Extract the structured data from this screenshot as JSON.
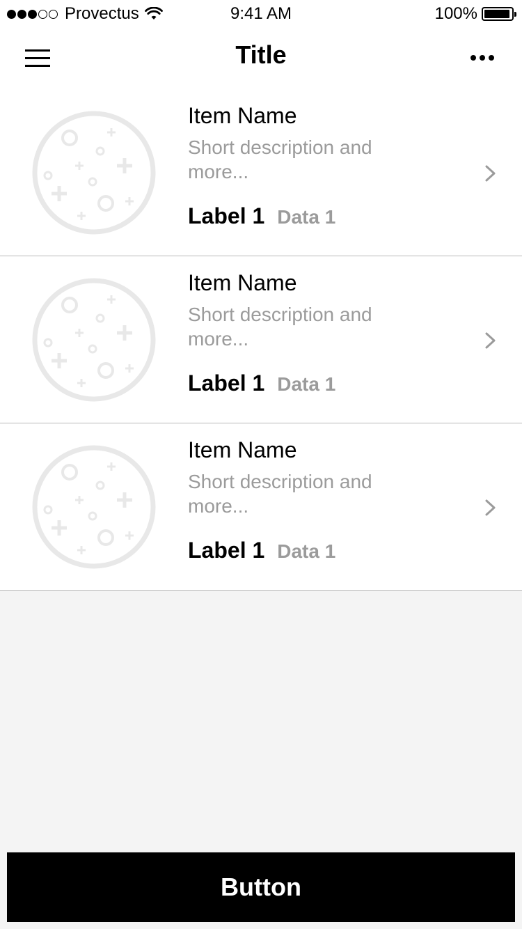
{
  "status_bar": {
    "signal_filled": 3,
    "signal_total": 5,
    "carrier": "Provectus",
    "time": "9:41 AM",
    "battery_percent": "100%",
    "battery_level": 1.0
  },
  "nav": {
    "title": "Title",
    "menu_icon": "hamburger-menu-icon",
    "more_icon": "more-dots-icon"
  },
  "list": {
    "items": [
      {
        "name": "Item Name",
        "description": "Short description and more...",
        "label": "Label 1",
        "data": "Data 1",
        "thumbnail_icon": "placeholder-image-icon",
        "chevron_icon": "chevron-right-icon"
      },
      {
        "name": "Item Name",
        "description": "Short description and more...",
        "label": "Label 1",
        "data": "Data 1",
        "thumbnail_icon": "placeholder-image-icon",
        "chevron_icon": "chevron-right-icon"
      },
      {
        "name": "Item Name",
        "description": "Short description and more...",
        "label": "Label 1",
        "data": "Data 1",
        "thumbnail_icon": "placeholder-image-icon",
        "chevron_icon": "chevron-right-icon"
      }
    ]
  },
  "footer": {
    "button_label": "Button"
  },
  "colors": {
    "background": "#f4f4f4",
    "surface": "#ffffff",
    "text_primary": "#000000",
    "text_secondary": "#9b9b9b",
    "placeholder": "#e8e8e8",
    "divider": "#b8b8b8",
    "button_background": "#000000",
    "button_text": "#ffffff"
  }
}
